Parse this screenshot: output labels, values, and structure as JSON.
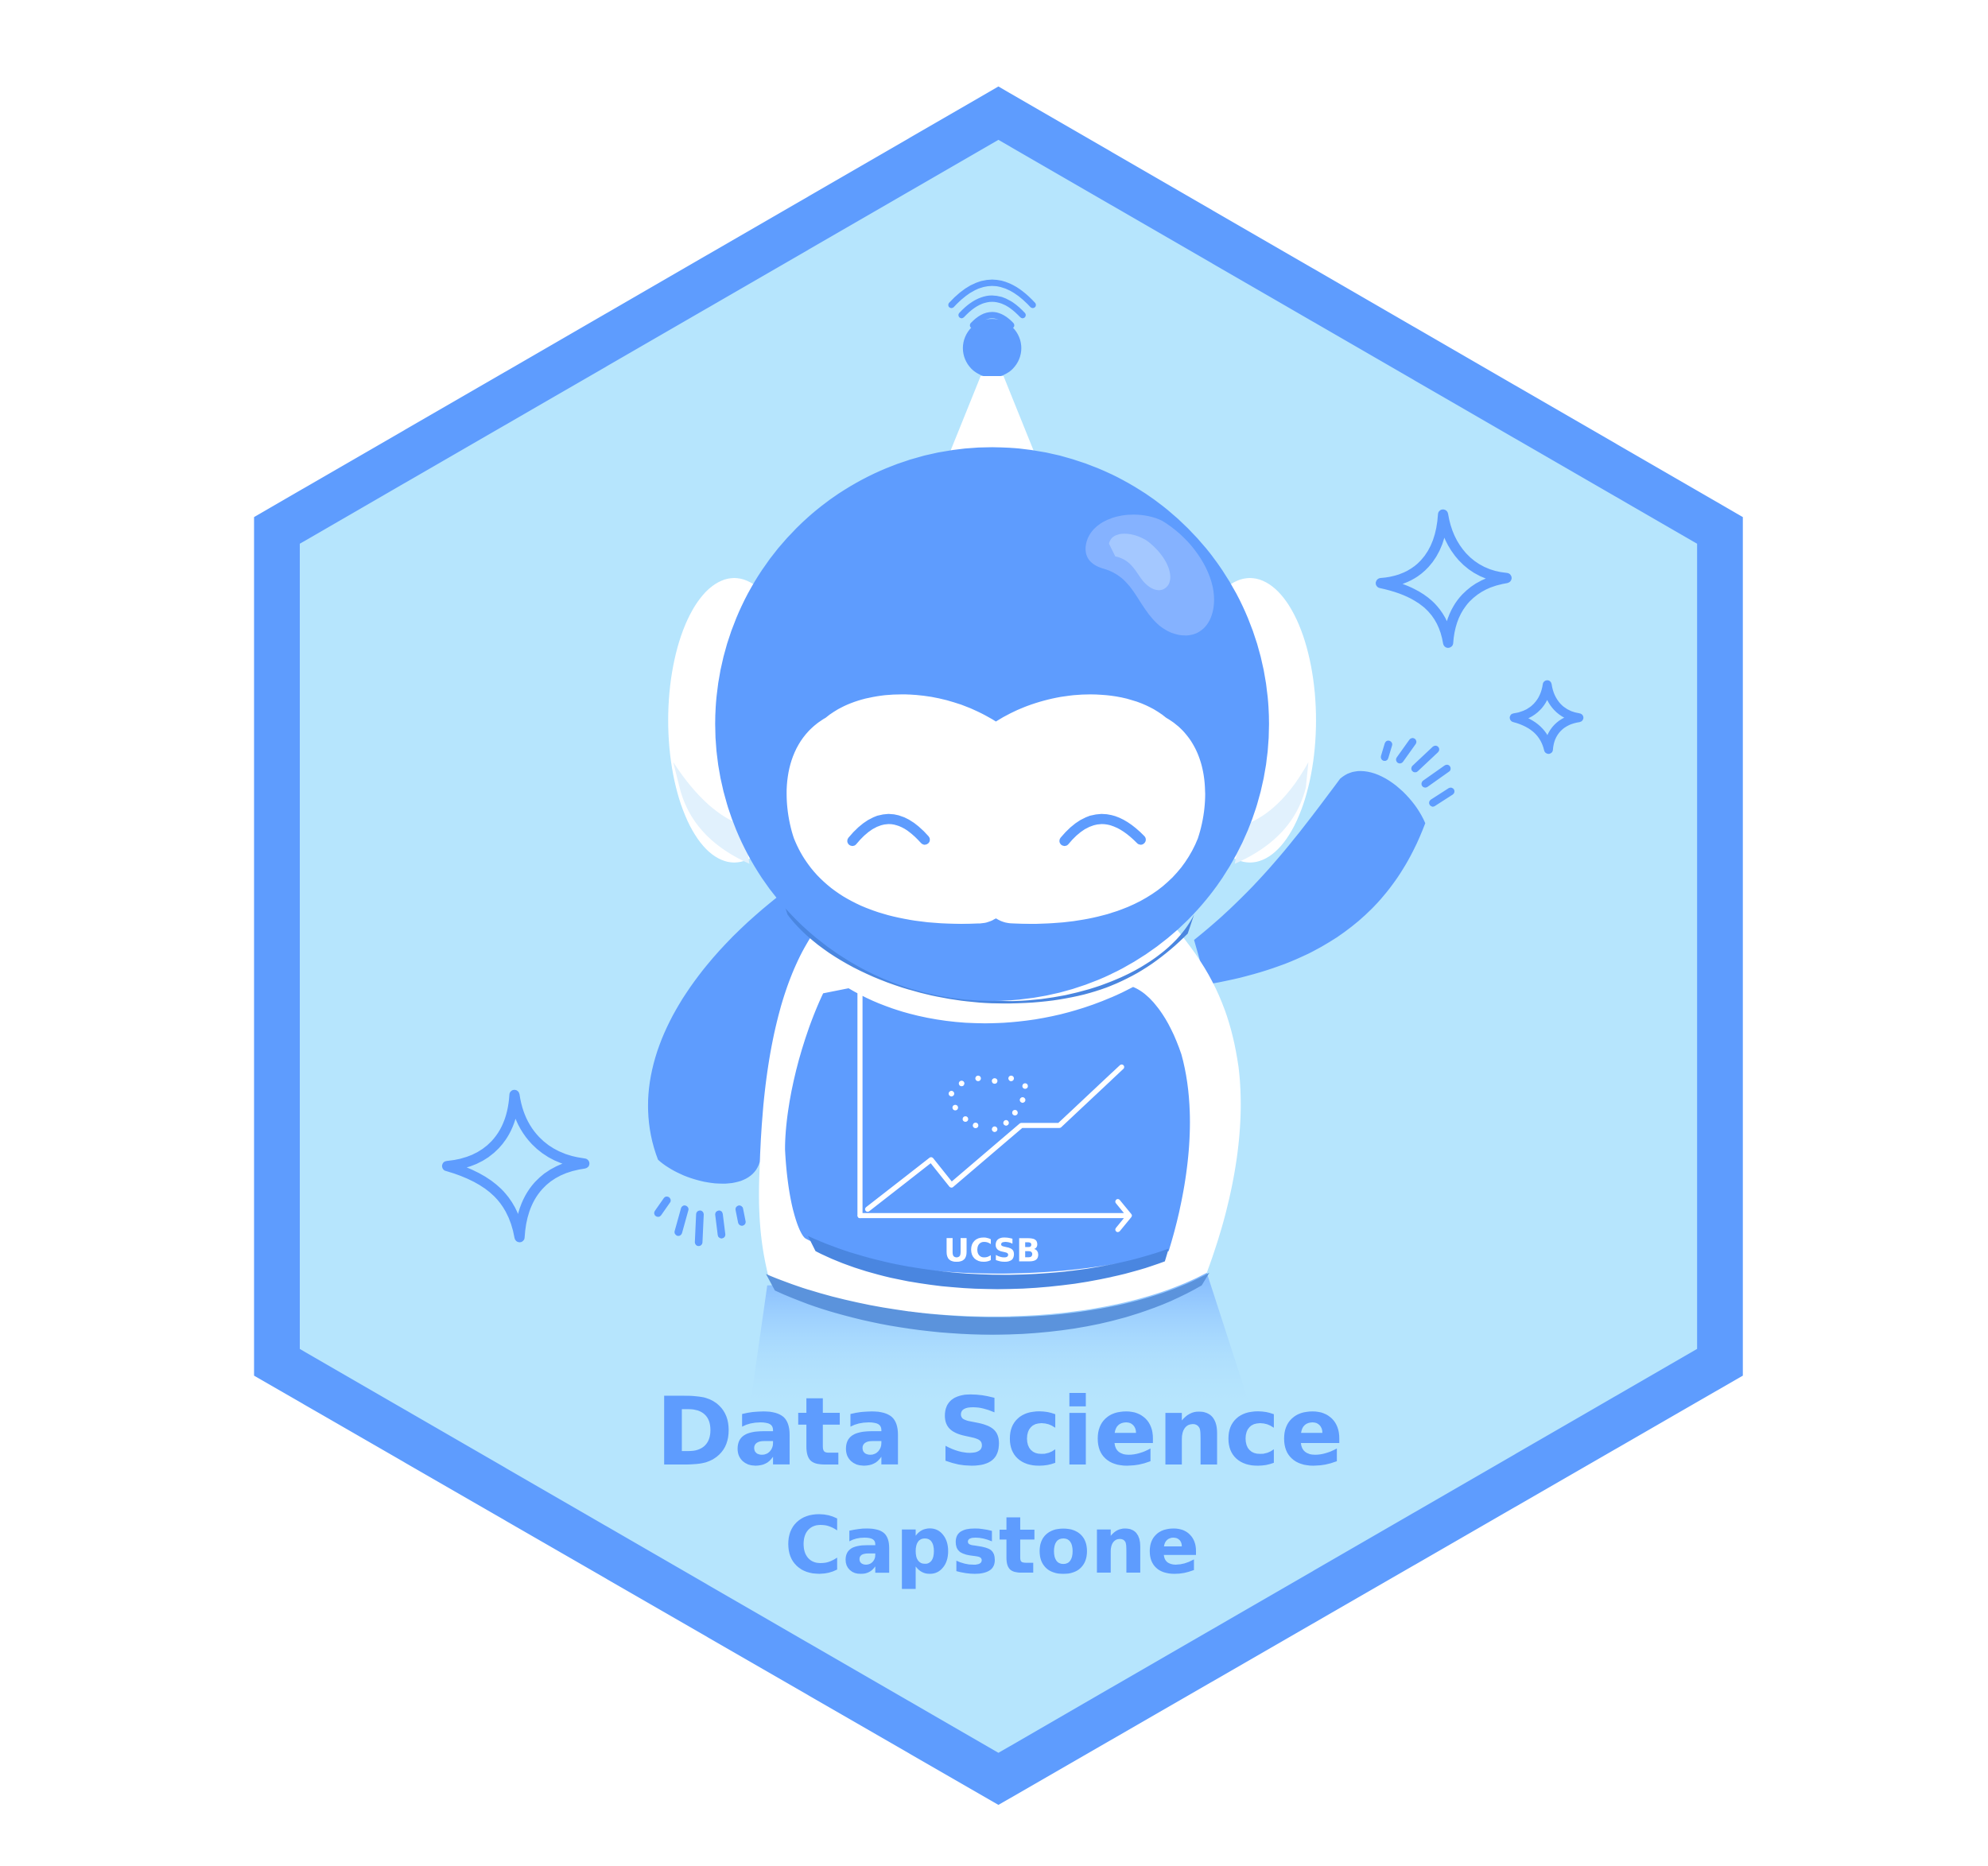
{
  "badge": {
    "title": "Data Science",
    "subtitle": "Capstone",
    "chest_label": "UCSB",
    "mascot": "robot-mascot-waving",
    "colors": {
      "primary_blue": "#5e9cfe",
      "dark_blue": "#4a86e0",
      "shadow_blue": "#5b93dc",
      "hex_fill": "#b6e5fd",
      "white": "#ffffff",
      "highlight": "#8fb8ff"
    }
  }
}
